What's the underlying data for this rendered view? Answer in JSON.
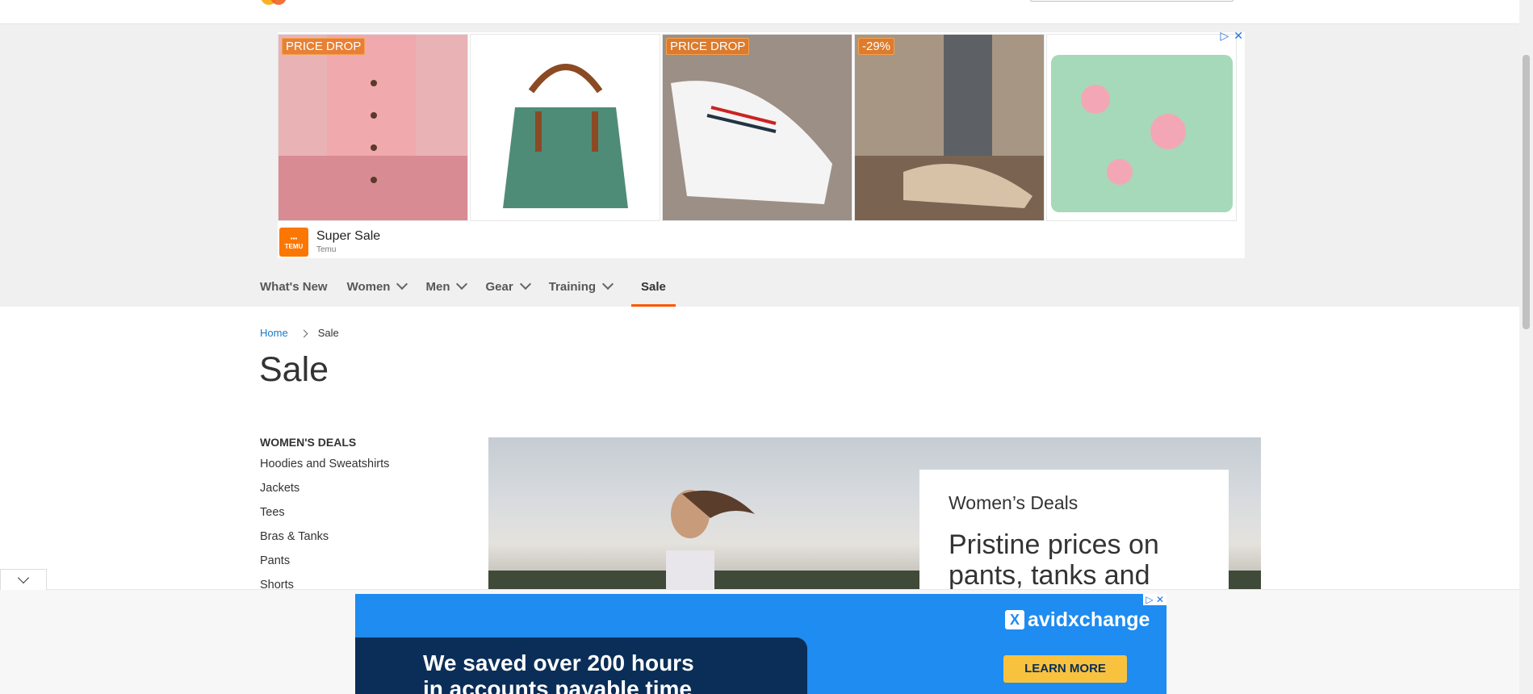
{
  "header": {
    "logo": "logo-icon",
    "search_placeholder": ""
  },
  "ad_top": {
    "tiles": [
      {
        "tag": "PRICE DROP",
        "item": "pink cardigan"
      },
      {
        "tag": "",
        "item": "green handbag"
      },
      {
        "tag": "PRICE DROP",
        "item": "white sneakers"
      },
      {
        "tag": "-29%",
        "item": "floral sandals"
      },
      {
        "tag": "",
        "item": "floral case"
      }
    ],
    "brand_icon": "temu-logo",
    "brand_logo_text": "TEMU",
    "title": "Super Sale",
    "advertiser": "Temu",
    "adchoices_icon": "▷",
    "close_icon": "✕"
  },
  "nav": {
    "items": [
      {
        "label": "What's New"
      },
      {
        "label": "Women"
      },
      {
        "label": "Men"
      },
      {
        "label": "Gear"
      },
      {
        "label": "Training"
      },
      {
        "label": "Sale"
      }
    ]
  },
  "breadcrumb": {
    "home": "Home",
    "current": "Sale"
  },
  "page_title": "Sale",
  "sidebar": {
    "heading": "WOMEN'S DEALS",
    "links": [
      "Hoodies and Sweatshirts",
      "Jackets",
      "Tees",
      "Bras & Tanks",
      "Pants",
      "Shorts"
    ]
  },
  "hero": {
    "kicker": "Women’s Deals",
    "headline": "Pristine prices on pants, tanks and"
  },
  "ad_bottom": {
    "brand": "avidxchange",
    "brand_mark": "X",
    "headline_1": "We saved over 200 hours",
    "headline_2": "in accounts payable time",
    "cta": "LEARN MORE",
    "adchoices_icon": "▷",
    "close_icon": "✕"
  },
  "colors": {
    "accent": "#ff5501",
    "link": "#1979c3",
    "temu": "#fb7701",
    "avid_blue": "#1e8cf0",
    "avid_navy": "#0a2e57",
    "cta_yellow": "#f8c23f"
  }
}
